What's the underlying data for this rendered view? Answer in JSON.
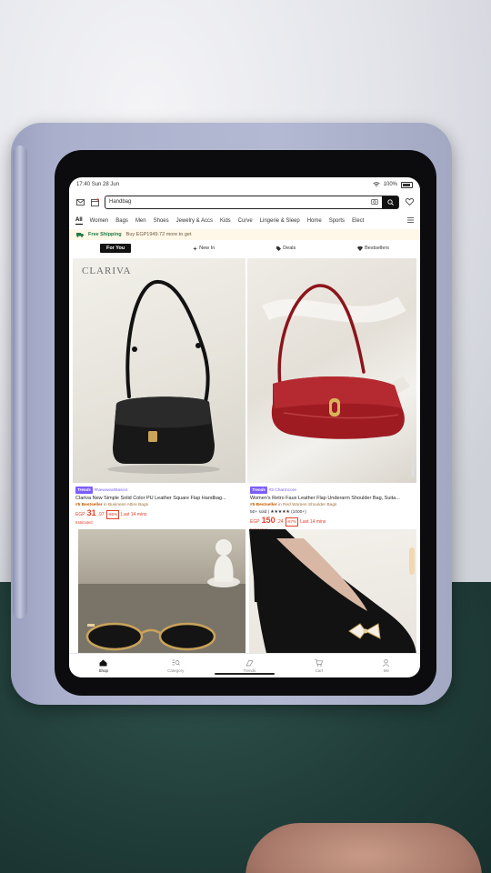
{
  "status_bar": {
    "time": "17:40",
    "date": "Sun 28 Jun",
    "battery": "100%"
  },
  "search": {
    "value": "Handbag"
  },
  "categories": [
    "All",
    "Women",
    "Bags",
    "Men",
    "Shoes",
    "Jewelry & Accs",
    "Kids",
    "Curve",
    "Lingerie & Sleep",
    "Home",
    "Sports",
    "Elect"
  ],
  "shipping_banner": {
    "label": "Free Shipping",
    "detail": "Buy EGP1949.72 more to get"
  },
  "feed_tabs": [
    "For You",
    "New In",
    "Deals",
    "Bestsellers"
  ],
  "products": [
    {
      "brand_logo": "CLARIVA",
      "badge": "Trends",
      "trend_tag": "#NewwearBasics",
      "title": "Clariva New Simple Solid Color PU Leather Square Flap Handbag...",
      "rank": "#5 Bestseller",
      "rank_category": "in Business Attire Bags",
      "currency": "EGP",
      "price": "31",
      "price_decimal": ".97",
      "discount": "-85%",
      "deal_note": "Last 14 mins",
      "estimated": "Estimated"
    },
    {
      "badge": "Trends",
      "trend_tag": "#3 Charmcore",
      "title": "Women's Retro Faux Leather Flap Underarm Shoulder Bag, Suita...",
      "rank": "#5 Bestseller",
      "rank_category": "in Red Women Shoulder Bags",
      "sold": "50+ sold",
      "rating_stars": "★★★★★",
      "reviews": "(1000+)",
      "currency": "EGP",
      "price": "150",
      "price_decimal": ".24",
      "discount": "-67%",
      "deal_note": "Last 14 mins",
      "estimated": "Estimated"
    }
  ],
  "bottom_nav": [
    "Shop",
    "Category",
    "Trends",
    "Cart",
    "Me"
  ],
  "colors": {
    "accent_purple": "#7b5cff",
    "price_red": "#e4402b",
    "bestseller_orange": "#c75a00",
    "bag_red": "#9e1b22"
  }
}
